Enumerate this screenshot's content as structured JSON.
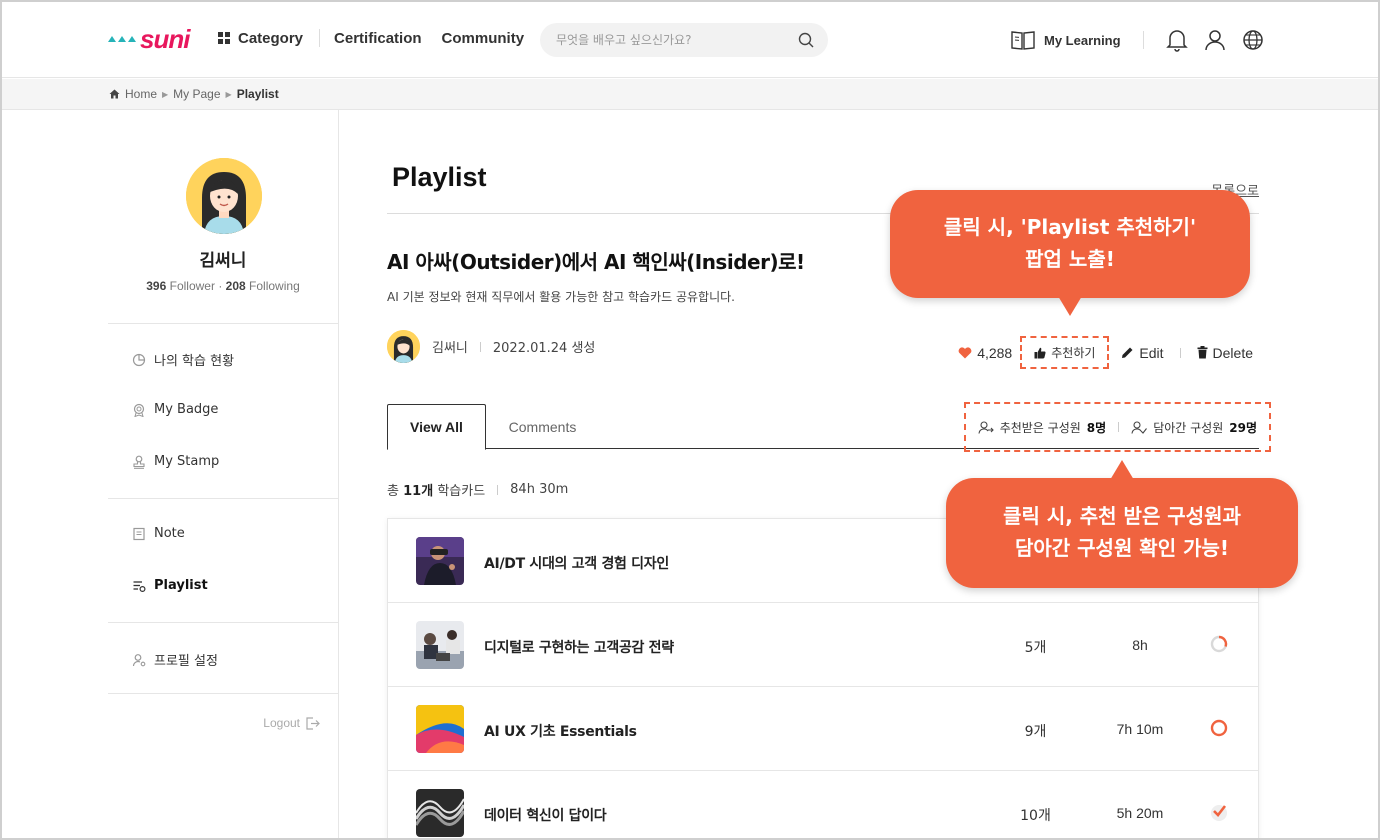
{
  "header": {
    "logo": "suni",
    "nav": {
      "category": "Category",
      "certification": "Certification",
      "community": "Community"
    },
    "search_placeholder": "무엇을 배우고 싶으신가요?",
    "my_learning": "My Learning"
  },
  "breadcrumb": {
    "home": "Home",
    "mypage": "My Page",
    "current": "Playlist"
  },
  "profile": {
    "name": "김써니",
    "followers": "396",
    "followers_label": "Follower",
    "following": "208",
    "following_label": "Following"
  },
  "sidebar": {
    "items": [
      {
        "label": "나의 학습 현황"
      },
      {
        "label": "My Badge"
      },
      {
        "label": "My Stamp"
      },
      {
        "label": "Note"
      },
      {
        "label": "Playlist"
      },
      {
        "label": "프로필 설정"
      }
    ],
    "logout": "Logout"
  },
  "main": {
    "page_title": "Playlist",
    "back_link": "목록으로",
    "playlist_title": "AI 아싸(Outsider)에서 AI 핵인싸(Insider)로!",
    "description": "AI 기본 정보와 현재 직무에서 활용 가능한 참고 학습카드 공유합니다.",
    "author": "김써니",
    "created": "2022.01.24 생성",
    "likes": "4,288",
    "recommend_label": "추천하기",
    "edit_label": "Edit",
    "delete_label": "Delete",
    "tabs": {
      "view_all": "View All",
      "comments": "Comments"
    },
    "members": {
      "recommended_label": "추천받은 구성원",
      "recommended_count": "8명",
      "saved_label": "담아간 구성원",
      "saved_count": "29명"
    },
    "summary": {
      "prefix": "총",
      "count": "11개",
      "suffix": "학습카드",
      "duration": "84h 30m"
    },
    "cards": [
      {
        "title": "AI/DT 시대의 고객 경험 디자인",
        "count": "",
        "time": "",
        "status": "none"
      },
      {
        "title": "디지털로 구현하는 고객공감 전략",
        "count": "5개",
        "time": "8h",
        "status": "in-progress"
      },
      {
        "title": "AI UX 기초 Essentials",
        "count": "9개",
        "time": "7h 10m",
        "status": "not-started"
      },
      {
        "title": "데이터 혁신이 답이다",
        "count": "10개",
        "time": "5h 20m",
        "status": "completed"
      }
    ]
  },
  "callouts": {
    "recommend_line1": "클릭 시, 'Playlist 추천하기'",
    "recommend_line2": "팝업 노출!",
    "members_line1": "클릭 시, 추천 받은 구성원과",
    "members_line2": "담아간 구성원 확인 가능!"
  },
  "colors": {
    "accent": "#f0633f",
    "brand": "#e8175d",
    "brand_secondary": "#26b3b8"
  }
}
